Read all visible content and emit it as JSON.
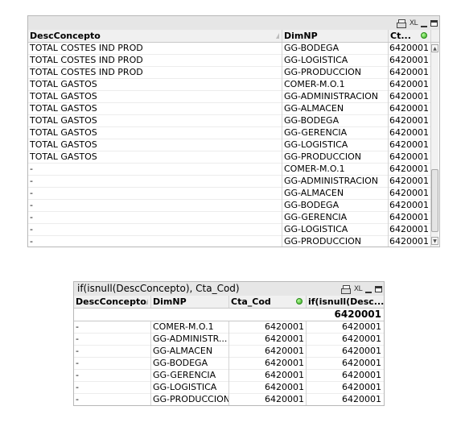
{
  "table1": {
    "icons": [
      "print-icon",
      "xl-export-icon",
      "minimize-icon",
      "maximize-icon"
    ],
    "xl_label": "XL",
    "columns": [
      "DescConcepto",
      "DimNP",
      "Ct..."
    ],
    "rows": [
      [
        "TOTAL COSTES IND PROD",
        "GG-BODEGA",
        "6420001"
      ],
      [
        "TOTAL COSTES IND PROD",
        "GG-LOGISTICA",
        "6420001"
      ],
      [
        "TOTAL COSTES IND PROD",
        "GG-PRODUCCION",
        "6420001"
      ],
      [
        "TOTAL GASTOS",
        "COMER-M.O.1",
        "6420001"
      ],
      [
        "TOTAL GASTOS",
        "GG-ADMINISTRACION",
        "6420001"
      ],
      [
        "TOTAL GASTOS",
        "GG-ALMACEN",
        "6420001"
      ],
      [
        "TOTAL GASTOS",
        "GG-BODEGA",
        "6420001"
      ],
      [
        "TOTAL GASTOS",
        "GG-GERENCIA",
        "6420001"
      ],
      [
        "TOTAL GASTOS",
        "GG-LOGISTICA",
        "6420001"
      ],
      [
        "TOTAL GASTOS",
        "GG-PRODUCCION",
        "6420001"
      ],
      [
        "-",
        "COMER-M.O.1",
        "6420001"
      ],
      [
        "-",
        "GG-ADMINISTRACION",
        "6420001"
      ],
      [
        "-",
        "GG-ALMACEN",
        "6420001"
      ],
      [
        "-",
        "GG-BODEGA",
        "6420001"
      ],
      [
        "-",
        "GG-GERENCIA",
        "6420001"
      ],
      [
        "-",
        "GG-LOGISTICA",
        "6420001"
      ],
      [
        "-",
        "GG-PRODUCCION",
        "6420001"
      ]
    ]
  },
  "table2": {
    "title": "if(isnull(DescConcepto),  Cta_Cod)",
    "xl_label": "XL",
    "columns": [
      "DescConcepto",
      "DimNP",
      "Cta_Cod",
      "if(isnull(Desc..."
    ],
    "total": "6420001",
    "rows": [
      [
        "-",
        "COMER-M.O.1",
        "6420001",
        "6420001"
      ],
      [
        "-",
        "GG-ADMINISTR...",
        "6420001",
        "6420001"
      ],
      [
        "-",
        "GG-ALMACEN",
        "6420001",
        "6420001"
      ],
      [
        "-",
        "GG-BODEGA",
        "6420001",
        "6420001"
      ],
      [
        "-",
        "GG-GERENCIA",
        "6420001",
        "6420001"
      ],
      [
        "-",
        "GG-LOGISTICA",
        "6420001",
        "6420001"
      ],
      [
        "-",
        "GG-PRODUCCION",
        "6420001",
        "6420001"
      ]
    ]
  }
}
